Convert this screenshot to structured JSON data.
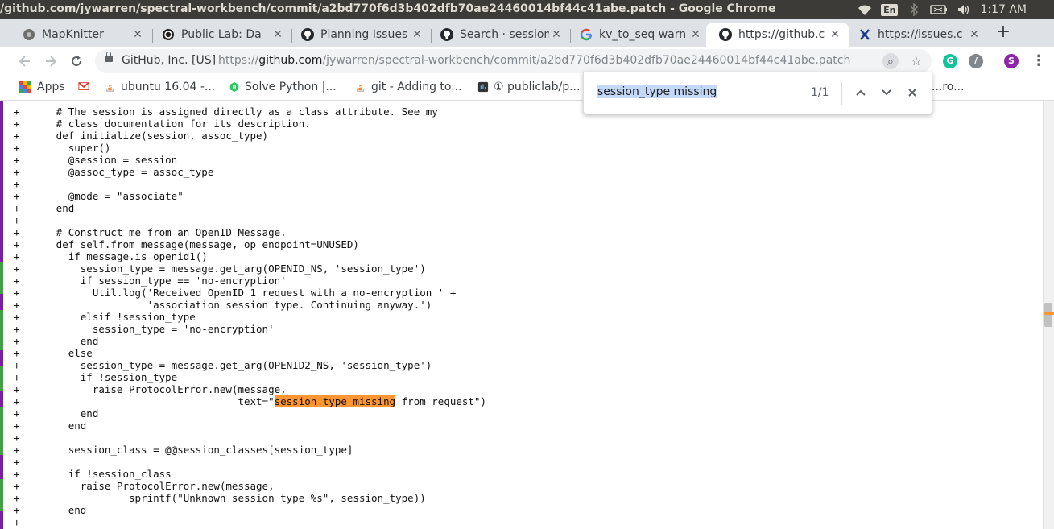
{
  "os": {
    "window_title": "/github.com/jywarren/spectral-workbench/commit/a2bd770f6d3b402dfb70ae24460014bf44c41abe.patch - Google Chrome",
    "keyboard_layout": "En",
    "clock": "1:17 AM"
  },
  "tabs": [
    {
      "title": "MapKnitter",
      "favicon": "mapknitter-icon",
      "active": false
    },
    {
      "title": "Public Lab: Da",
      "favicon": "publiclab-icon",
      "active": false
    },
    {
      "title": "Planning Issues",
      "favicon": "github-icon",
      "active": false
    },
    {
      "title": "Search · session",
      "favicon": "github-icon",
      "active": false
    },
    {
      "title": "kv_to_seq warn",
      "favicon": "google-icon",
      "active": false
    },
    {
      "title": "https://github.c",
      "favicon": "github-icon",
      "active": true
    },
    {
      "title": "https://issues.c",
      "favicon": "issues-icon",
      "active": false
    }
  ],
  "toolbar": {
    "site_identity": "GitHub, Inc. [US]",
    "url_scheme": "https://",
    "url_host": "github.com",
    "url_path": "/jywarren/spectral-workbench/commit/a2bd770f6d3b402dfb70ae24460014bf44c41abe.patch",
    "profile_initial": "S"
  },
  "bookmarks": [
    {
      "label": "Apps",
      "icon": "apps-grid-icon"
    },
    {
      "label": "",
      "icon": "gmail-icon"
    },
    {
      "label": "ubuntu 16.04 -...",
      "icon": "stackoverflow-icon"
    },
    {
      "label": "Solve Python |...",
      "icon": "hackerrank-icon"
    },
    {
      "label": "git - Adding to...",
      "icon": "stackoverflow-icon"
    },
    {
      "label": "① publiclab/p...",
      "icon": "bookmark-app-icon"
    },
    {
      "label": "...ro...",
      "icon": ""
    }
  ],
  "find_bar": {
    "query": "session_type missing",
    "count": "1/1"
  },
  "code_lines": [
    "+      # The session is assigned directly as a class attribute. See my",
    "+      # class documentation for its description.",
    "+      def initialize(session, assoc_type)",
    "+        super()",
    "+        @session = session",
    "+        @assoc_type = assoc_type",
    "+",
    "+        @mode = \"associate\"",
    "+      end",
    "+",
    "+      # Construct me from an OpenID Message.",
    "+      def self.from_message(message, op_endpoint=UNUSED)",
    "+        if message.is_openid1()",
    "+          session_type = message.get_arg(OPENID_NS, 'session_type')",
    "+          if session_type == 'no-encryption'",
    "+            Util.log('Received OpenID 1 request with a no-encryption ' +",
    "+                     'association session type. Continuing anyway.')",
    "+          elsif !session_type",
    "+            session_type = 'no-encryption'",
    "+          end",
    "+        else",
    "+          session_type = message.get_arg(OPENID2_NS, 'session_type')",
    "+          if !session_type",
    "+            raise ProtocolError.new(message,",
    "+                                    text=\"session_type missing from request\")",
    "+          end",
    "+        end",
    "+",
    "+        session_class = @@session_classes[session_type]",
    "+",
    "+        if !session_class",
    "+          raise ProtocolError.new(message,",
    "+                  sprintf(\"Unknown session type %s\", session_type))",
    "+        end",
    "+"
  ],
  "highlight": "session_type missing",
  "colors": {
    "find_highlight": "#ff9632",
    "left_strip_purple": "#7b1fa2",
    "left_strip_green": "#43a047"
  }
}
